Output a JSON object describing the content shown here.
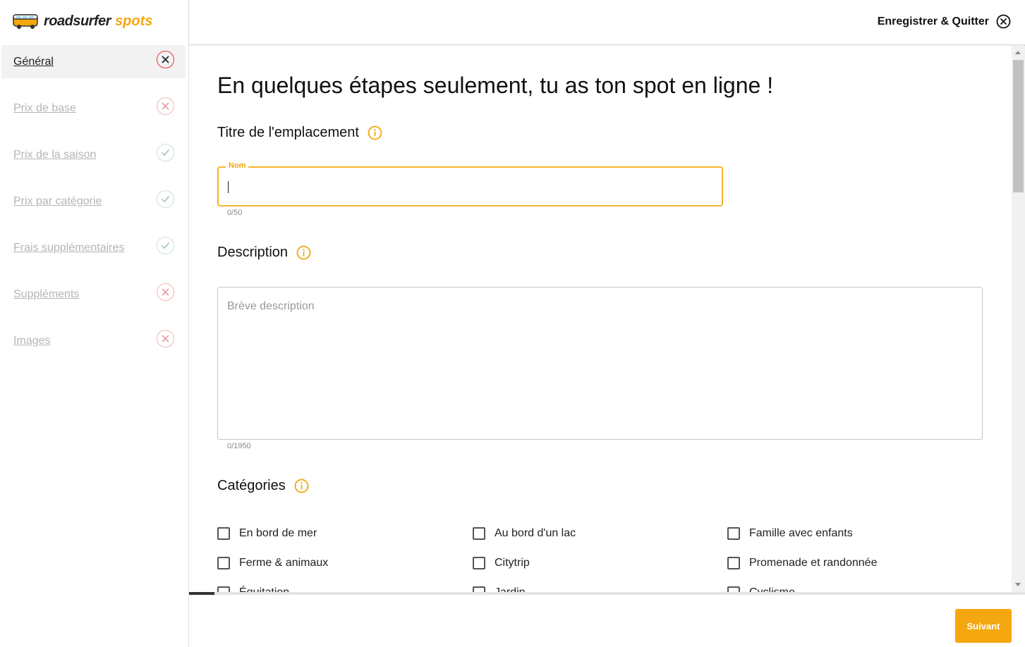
{
  "brand": {
    "name": "roadsurfer",
    "sub": "spots",
    "accent": "#f5a70f"
  },
  "header": {
    "save_quit_label": "Enregistrer & Quitter",
    "close_icon": "close-circle-icon"
  },
  "sidebar": {
    "items": [
      {
        "label": "Général",
        "status": "error",
        "active": true
      },
      {
        "label": "Prix de base",
        "status": "error"
      },
      {
        "label": "Prix de la saison",
        "status": "ok"
      },
      {
        "label": "Prix par catégorie",
        "status": "ok"
      },
      {
        "label": "Frais supplémentaires",
        "status": "ok"
      },
      {
        "label": "Suppléments",
        "status": "error"
      },
      {
        "label": "Images",
        "status": "error"
      }
    ]
  },
  "main": {
    "heading": "En quelques étapes seulement, tu as ton spot en ligne !",
    "title_section": {
      "label": "Titre de l'emplacement",
      "field_legend": "Nom",
      "value": "",
      "counter": "0/50"
    },
    "description_section": {
      "label": "Description",
      "placeholder": "Brève description",
      "counter": "0/1950"
    },
    "categories_section": {
      "label": "Catégories",
      "options": [
        {
          "label": "En bord de mer",
          "checked": false
        },
        {
          "label": "Au bord d'un lac",
          "checked": false
        },
        {
          "label": "Famille avec enfants",
          "checked": false
        },
        {
          "label": "Ferme & animaux",
          "checked": false
        },
        {
          "label": "Citytrip",
          "checked": false
        },
        {
          "label": "Promenade et randonnée",
          "checked": false
        },
        {
          "label": "Équitation",
          "checked": false
        },
        {
          "label": "Jardin",
          "checked": false
        },
        {
          "label": "Cyclisme",
          "checked": false
        }
      ]
    }
  },
  "footer": {
    "next_label": "Suivant",
    "progress": 0.03
  }
}
